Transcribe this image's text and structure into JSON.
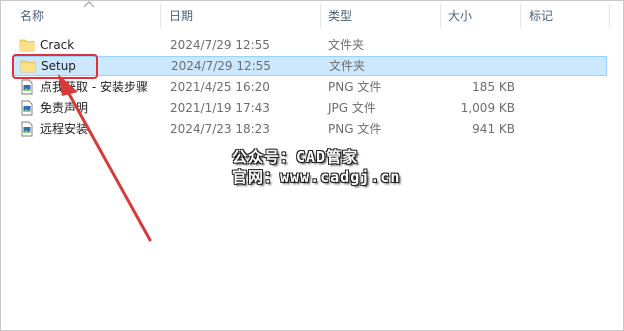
{
  "columns": {
    "name": "名称",
    "date": "日期",
    "type": "类型",
    "size": "大小",
    "tags": "标记"
  },
  "rows": [
    {
      "name": "Crack",
      "date": "2024/7/29 12:55",
      "type": "文件夹",
      "size": "",
      "icon": "folder-icon",
      "selected": false
    },
    {
      "name": "Setup",
      "date": "2024/7/29 12:55",
      "type": "文件夹",
      "size": "",
      "icon": "folder-icon",
      "selected": true
    },
    {
      "name": "点我获取 - 安装步骤",
      "date": "2021/4/25 16:20",
      "type": "PNG 文件",
      "size": "185 KB",
      "icon": "image-file-icon",
      "selected": false
    },
    {
      "name": "免责声明",
      "date": "2021/1/19 17:43",
      "type": "JPG 文件",
      "size": "1,009 KB",
      "icon": "image-file-icon",
      "selected": false
    },
    {
      "name": "远程安装",
      "date": "2024/7/23 18:23",
      "type": "PNG 文件",
      "size": "941 KB",
      "icon": "image-file-icon",
      "selected": false
    }
  ],
  "watermark": {
    "line1": "公众号：CAD管家",
    "line2": "官网：www.cadgj.cn"
  },
  "colors": {
    "selected_bg": "#cce8ff",
    "selected_border": "#99d1ff",
    "highlight": "#e0303c",
    "header_text": "#4c607a",
    "folder": "#f8d775"
  }
}
